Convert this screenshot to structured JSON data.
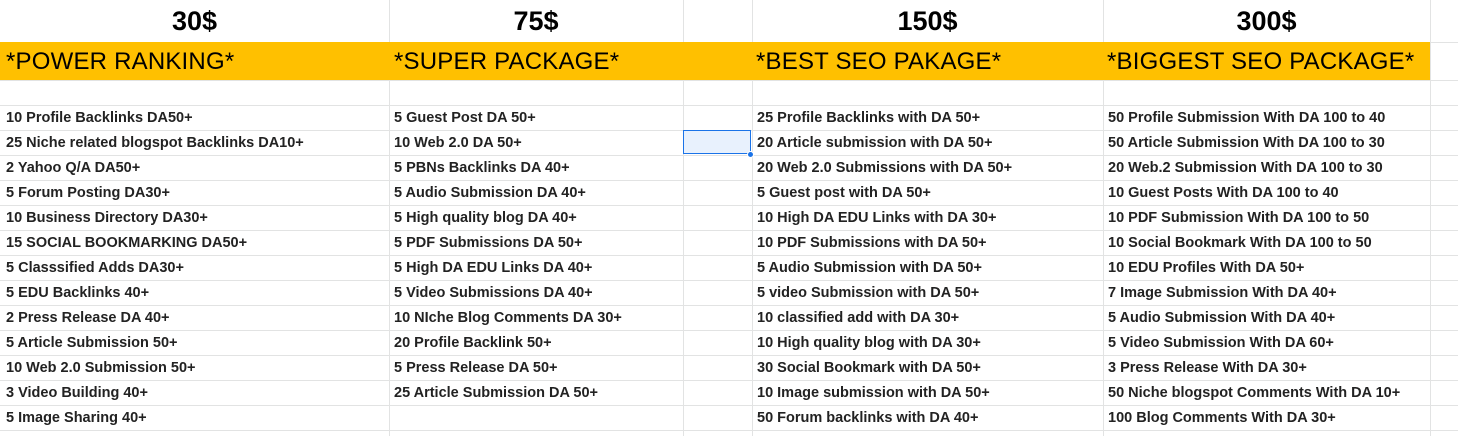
{
  "columns": [
    {
      "price": "30$",
      "title": "*POWER RANKING*",
      "items": [
        "10 Profile Backlinks DA50+",
        "25 Niche related blogspot Backlinks DA10+",
        "2 Yahoo Q/A DA50+",
        "5 Forum Posting DA30+",
        "10 Business Directory DA30+",
        "15 SOCIAL BOOKMARKING DA50+",
        "5 Classsified Adds DA30+",
        "5 EDU Backlinks 40+",
        "2 Press Release DA 40+",
        "5 Article Submission 50+",
        "10 Web 2.0 Submission 50+",
        "3 Video Building 40+",
        "5 Image Sharing 40+"
      ]
    },
    {
      "price": "75$",
      "title": "*SUPER PACKAGE*",
      "items": [
        "5 Guest Post DA 50+",
        "10 Web 2.0 DA 50+",
        "5 PBNs Backlinks DA 40+",
        "5 Audio Submission DA 40+",
        "5 High quality blog DA 40+",
        "5 PDF Submissions DA 50+",
        "5 High DA EDU Links DA 40+",
        "5 Video Submissions DA 40+",
        "10 NIche Blog Comments DA 30+",
        "20 Profile Backlink 50+",
        "5 Press Release DA 50+",
        "25 Article Submission DA 50+"
      ]
    },
    {
      "price": "150$",
      "title": "*BEST SEO PAKAGE*",
      "items": [
        "25 Profile Backlinks with DA 50+",
        "20 Article submission with DA 50+",
        "20 Web 2.0 Submissions with DA 50+",
        "5 Guest post with DA 50+",
        "10 High DA EDU Links with DA 30+",
        "10 PDF Submissions with DA 50+",
        "5 Audio Submission with DA 50+",
        "5 video  Submission with DA 50+",
        "10 classified add with DA 30+",
        "10 High quality blog with DA 30+",
        "30 Social Bookmark with DA 50+",
        "10 Image submission with DA 50+",
        "50 Forum backlinks with DA 40+"
      ]
    },
    {
      "price": "300$",
      "title": "*BIGGEST SEO PACKAGE*",
      "items": [
        "50 Profile Submission With DA 100 to 40",
        "50 Article Submission With DA 100 to 30",
        "20 Web.2 Submission With DA 100 to 30",
        "10 Guest Posts With DA 100 to 40",
        "10 PDF Submission With DA 100 to 50",
        "10 Social Bookmark With DA 100 to 50",
        "10 EDU Profiles With DA 50+",
        "7 Image Submission With DA 40+",
        "5 Audio Submission With DA 40+",
        "5 Video Submission With DA 60+",
        "3 Press Release With DA 30+",
        "50 Niche blogspot Comments With DA 10+",
        "100 Blog Comments With DA 30+"
      ]
    }
  ],
  "colors": {
    "title_band": "#ffc000",
    "gridline": "#e2e3e3",
    "selection": "#1a73e8"
  }
}
